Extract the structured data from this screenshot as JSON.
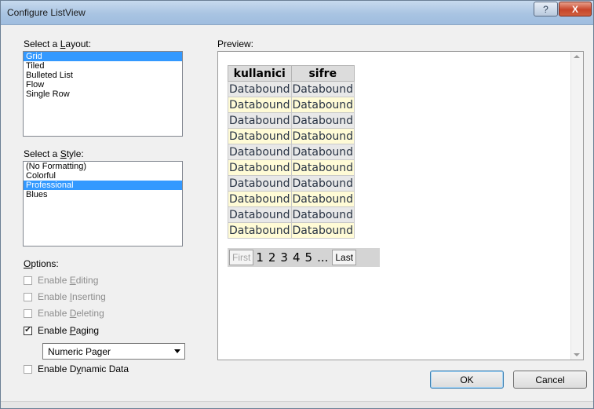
{
  "window": {
    "title": "Configure ListView"
  },
  "titlebar": {
    "help_glyph": "?",
    "close_glyph": "X"
  },
  "layout": {
    "label_pre": "Select a ",
    "label_key": "L",
    "label_post": "ayout:",
    "items": [
      "Grid",
      "Tiled",
      "Bulleted List",
      "Flow",
      "Single Row"
    ],
    "selected": "Grid"
  },
  "style": {
    "label_pre": "Select a ",
    "label_key": "S",
    "label_post": "tyle:",
    "items": [
      "(No Formatting)",
      "Colorful",
      "Professional",
      "Blues"
    ],
    "selected": "Professional"
  },
  "options": {
    "label_pre": "",
    "label_key": "O",
    "label_post": "ptions:",
    "items": [
      {
        "pre": "Enable ",
        "key": "E",
        "post": "diting",
        "checked": false,
        "enabled": false
      },
      {
        "pre": "Enable ",
        "key": "I",
        "post": "nserting",
        "checked": false,
        "enabled": false
      },
      {
        "pre": "Enable ",
        "key": "D",
        "post": "eleting",
        "checked": false,
        "enabled": false
      },
      {
        "pre": "Enable ",
        "key": "P",
        "post": "aging",
        "checked": true,
        "enabled": true
      }
    ],
    "pager_type": "Numeric Pager",
    "dynamic": {
      "pre": "Enable D",
      "key": "y",
      "post": "namic Data",
      "checked": false,
      "enabled": true
    }
  },
  "preview": {
    "label": "Preview:",
    "columns": [
      "kullanici",
      "sifre"
    ],
    "cell_text": "Databound",
    "row_count": 10,
    "pager": {
      "first": "First",
      "pages": [
        "1",
        "2",
        "3",
        "4",
        "5",
        "..."
      ],
      "last": "Last"
    }
  },
  "buttons": {
    "ok": "OK",
    "cancel": "Cancel"
  },
  "colors": {
    "selection": "#3399ff",
    "row_alt": "#fffbd6",
    "row_base": "#e8e8e8"
  }
}
